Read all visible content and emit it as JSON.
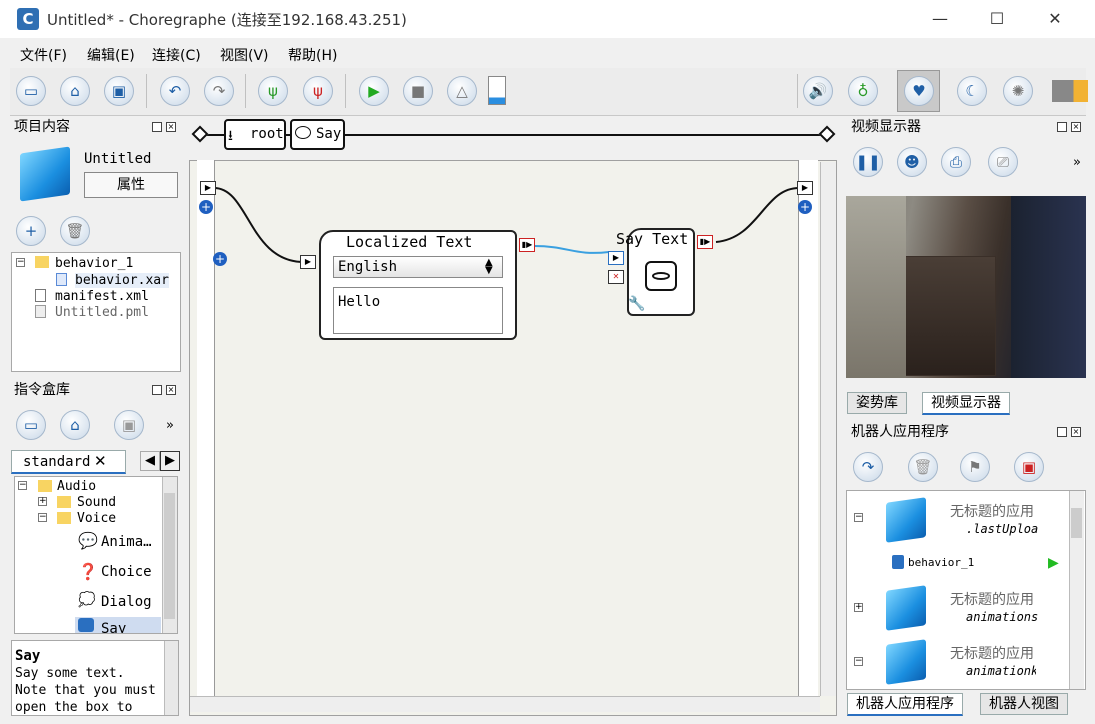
{
  "window": {
    "title": "Untitled* - Choregraphe (连接至192.168.43.251)",
    "app_icon_letter": "C",
    "minimize": "—",
    "maximize": "☐",
    "close": "✕"
  },
  "menu": [
    "文件(F)",
    "编辑(E)",
    "连接(C)",
    "视图(V)",
    "帮助(H)"
  ],
  "toolbar_icons": [
    "new-file-icon",
    "open-folder-icon",
    "save-icon",
    "undo-icon",
    "redo-icon",
    "connect-icon",
    "disconnect-icon",
    "play-icon",
    "stop-icon",
    "debug-icon",
    "battery-icon",
    "volume-icon",
    "robot-pose-icon",
    "heart-icon",
    "sleep-icon",
    "wake-icon",
    "battery-level-icon"
  ],
  "project_panel": {
    "title": "项目内容",
    "project_name": "Untitled",
    "properties_button": "属性",
    "files": [
      "behavior_1",
      "behavior.xar",
      "manifest.xml",
      "Untitled.pml"
    ]
  },
  "library_panel": {
    "title": "指令盒库",
    "tab_label": "standard",
    "tree": [
      "Audio",
      "Sound",
      "Voice",
      "Anima…",
      "Choice",
      "Dialog",
      "Say"
    ]
  },
  "description": {
    "title": "Say",
    "lines": [
      "Say some text.",
      "Note that you must",
      "open the box to"
    ]
  },
  "breadcrumb": [
    "root",
    "Say"
  ],
  "canvas": {
    "localized_box": {
      "title": "Localized Text",
      "language": "English",
      "text": "Hello"
    },
    "say_box": {
      "title": "Say Text"
    }
  },
  "video_panel": {
    "title": "视频显示器",
    "tabs": [
      "姿势库",
      "视频显示器"
    ]
  },
  "apps_panel": {
    "title": "机器人应用程序",
    "apps": [
      {
        "name": "无标题的应用",
        "sub": ".lastUploa"
      },
      {
        "name": "无标题的应用",
        "sub": "animations"
      },
      {
        "name": "无标题的应用",
        "sub": "animationk"
      }
    ],
    "child_behavior": "behavior_1",
    "bottom_tabs": [
      "机器人应用程序",
      "机器人视图"
    ]
  },
  "colors": {
    "accent": "#2a6fc0",
    "link_wire": "#3aa0e0",
    "play_green": "#22bb22"
  }
}
